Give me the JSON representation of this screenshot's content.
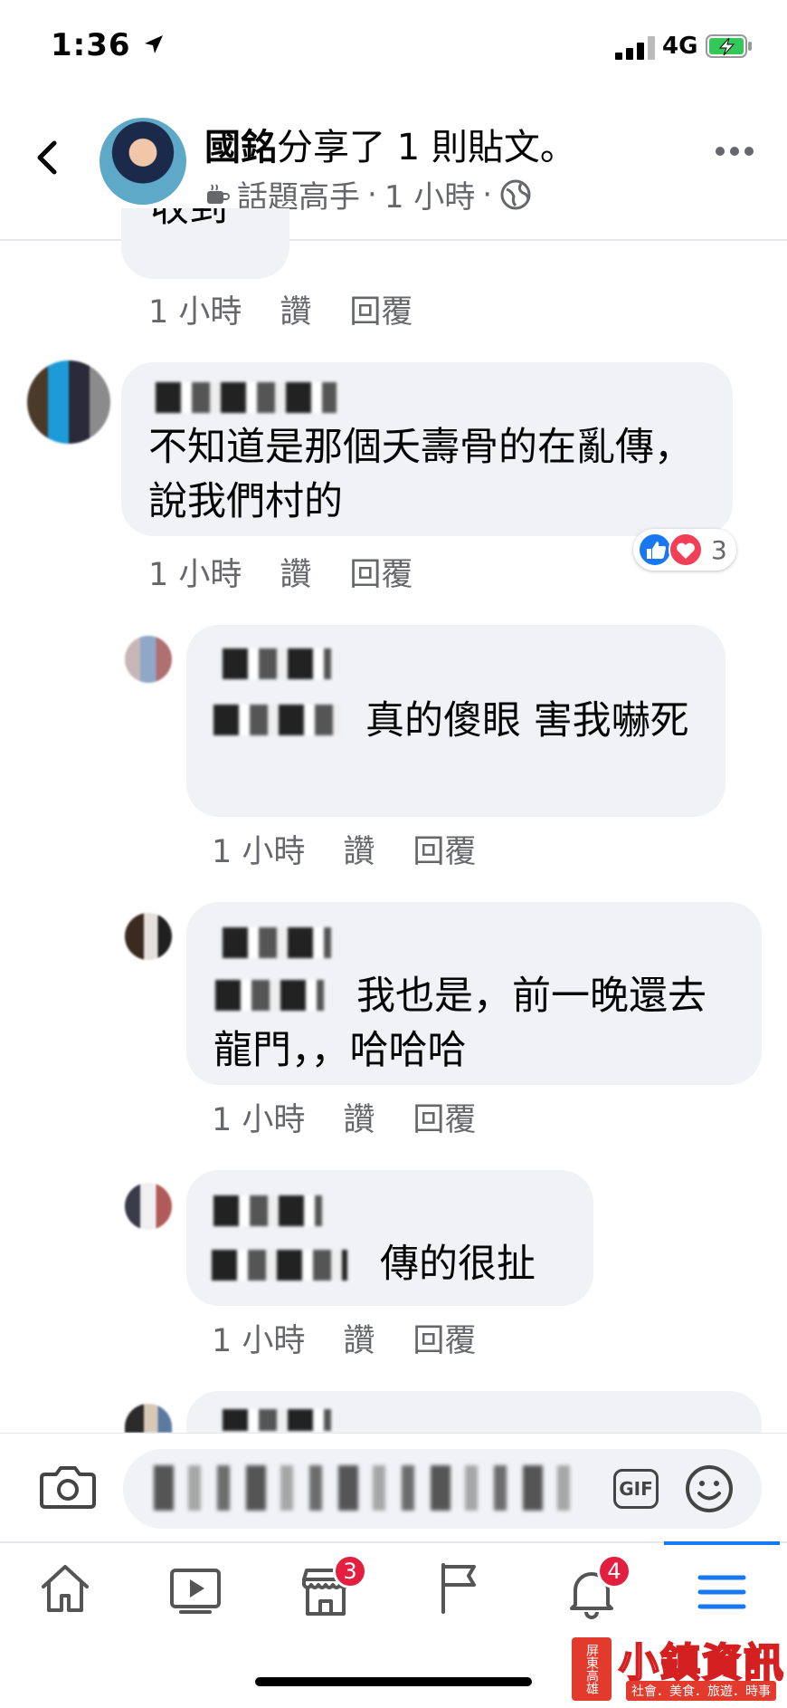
{
  "status_bar": {
    "time": "1:36",
    "network": "4G"
  },
  "header": {
    "author": "國銘",
    "action": "分享了 1 則貼文。",
    "badge": "話題高手",
    "time": "1 小時"
  },
  "partial_comment": {
    "text": "收到",
    "time": "1 小時",
    "like": "讚",
    "reply": "回覆"
  },
  "comments": [
    {
      "text": "不知道是那個夭壽骨的在亂傳，說我們村的",
      "time": "1 小時",
      "like": "讚",
      "reply": "回覆",
      "reaction_count": "3"
    },
    {
      "text": "真的傻眼 害我嚇死",
      "time": "1 小時",
      "like": "讚",
      "reply": "回覆"
    },
    {
      "text": "我也是，前一晚還去龍門，，哈哈哈",
      "time": "1 小時",
      "like": "讚",
      "reply": "回覆"
    },
    {
      "text": "傳的很扯",
      "time": "1 小時",
      "like": "讚",
      "reply": "回覆"
    }
  ],
  "composer": {
    "gif_label": "GIF"
  },
  "tabbar": {
    "marketplace_badge": "3",
    "notifications_badge": "4"
  },
  "watermark": {
    "vertical": "屏東高雄",
    "title": "小鎮資訊",
    "subtitle": "社會．美食．旅遊．時事"
  },
  "colors": {
    "accent": "#1877f2",
    "badge": "#e41e3f",
    "bubble": "#f0f2f5",
    "meta": "#65676b"
  }
}
